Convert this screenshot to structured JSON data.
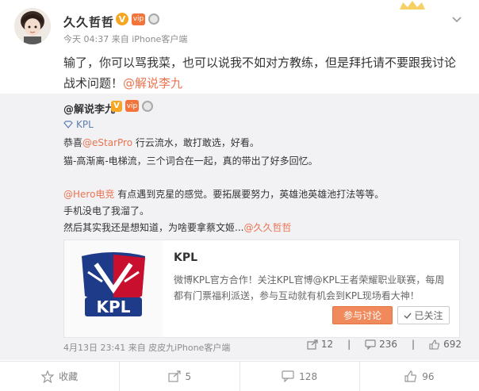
{
  "post": {
    "username": "久久哲哲",
    "badge_v": "V",
    "badge_vip": "vip",
    "meta": "今天 04:37 来自 iPhone客户端",
    "text_main": "输了，你可以骂我菜，也可以说我不如对方教练，但是拜托请不要跟我讨论战术问题！",
    "mention": "@解说李九"
  },
  "repost": {
    "username": "@解说李九",
    "badge_v": "V",
    "badge_vip": "vip",
    "kpl_tag": "KPL",
    "line1_prefix": "恭喜",
    "line1_mention": "@eStarPro",
    "line1_suffix": " 行云流水，敢打敢选，好看。",
    "line2": "猫-高渐离-电梯流，三个词合在一起，真的带出了好多回忆。",
    "line3_mention": "@Hero电竞",
    "line3_suffix": " 有点遇到克星的感觉。要拓展要努力，英雄池英雄池打法等等。",
    "line4": "手机没电了我溜了。",
    "line5_prefix": "然后其实我还是想知道，为啥要拿蔡文姬...",
    "line5_mention": "@久久哲哲",
    "card": {
      "title": "KPL",
      "logo_text": "KPL",
      "description": "微博KPL官方合作！关注KPL官博@KPL王者荣耀职业联赛，每周都有门票福利派送，参与互动就有机会到KPL现场看大神！",
      "join_label": "参与讨论",
      "followed_label": "已关注"
    },
    "footer": "4月13日 23:41 来自 皮皮九iPhone客户端",
    "repost_count": "12",
    "comment_count": "236",
    "like_count": "692"
  },
  "actions": {
    "favorite": "收藏",
    "repost": "5",
    "comment": "128",
    "like": "96"
  },
  "colors": {
    "accent": "#eb7350",
    "link_blue": "#5d7fae",
    "badge_orange": "#f5a623"
  }
}
